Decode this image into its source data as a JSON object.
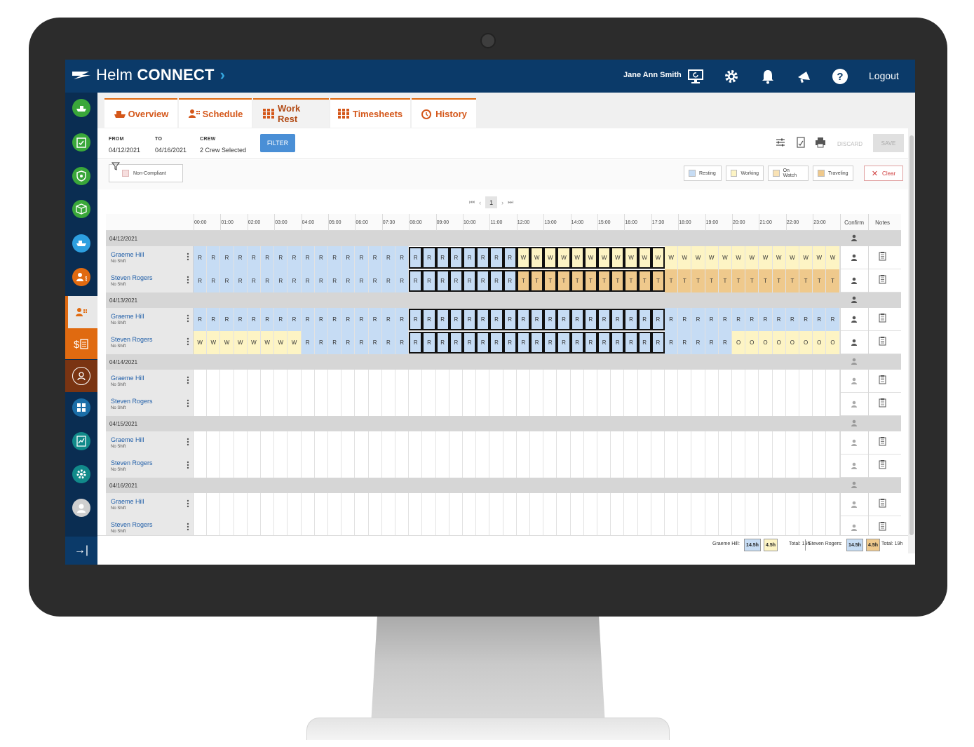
{
  "app": {
    "logo_text": "Helm",
    "logo_bold": "CONNECT",
    "logo_chevron": "›"
  },
  "header": {
    "user": "Jane Ann Smith",
    "logout": "Logout",
    "icons": [
      "monitor-icon",
      "gear-icon",
      "bell-icon",
      "megaphone-icon",
      "help-icon"
    ]
  },
  "tabs": [
    {
      "label": "Overview",
      "icon": "ship-icon"
    },
    {
      "label": "Schedule",
      "icon": "crew-schedule-icon"
    },
    {
      "label": "Work Rest",
      "icon": "grid-icon",
      "active": true
    },
    {
      "label": "Timesheets",
      "icon": "grid-icon"
    },
    {
      "label": "History",
      "icon": "history-icon"
    }
  ],
  "filter": {
    "from_label": "FROM",
    "from": "04/12/2021",
    "to_label": "TO",
    "to": "04/16/2021",
    "crew_label": "CREW",
    "crew": "2 Crew Selected",
    "filter_btn": "FILTER",
    "discard": "DISCARD",
    "save": "SAVE"
  },
  "legend": {
    "non_compliant": "Non-Compliant",
    "items": [
      {
        "label": "Resting",
        "color": "#c6dcf4"
      },
      {
        "label": "Working",
        "color": "#fdf4c4"
      },
      {
        "label": "On Watch",
        "color": "#f9e2b4"
      },
      {
        "label": "Traveling",
        "color": "#efc98c"
      }
    ],
    "clear": "Clear"
  },
  "pager": {
    "first": "⏮",
    "prev": "‹",
    "page": "1",
    "next": "›",
    "last": "⏭"
  },
  "columns": {
    "hours": [
      "00:00",
      "01:00",
      "02:00",
      "03:00",
      "04:00",
      "05:00",
      "06:00",
      "07:30",
      "08:00",
      "09:00",
      "10:00",
      "11:00",
      "12:00",
      "13:00",
      "14:00",
      "15:00",
      "16:00",
      "17:30",
      "18:00",
      "19:00",
      "20:00",
      "21:00",
      "22:00",
      "23:00"
    ],
    "confirm": "Confirm",
    "notes": "Notes"
  },
  "colors": {
    "R": "#c6dcf4",
    "W": "#fdf4c4",
    "T": "#efc98c",
    "O": "#fdf4c4",
    "": "#ffffff"
  },
  "days": [
    {
      "date": "04/12/2021",
      "crew": [
        {
          "name": "Graeme Hill",
          "shift": "No Shift",
          "cells": "RRRRRRRRRRRRRRRRRRRRRRRRWWWWWWWWWWWWWWWWWWWWWWWW"
        },
        {
          "name": "Steven Rogers",
          "shift": "No Shift",
          "cells": "RRRRRRRRRRRRRRRRRRRRRRRRTTTTTTTTTTTTTTTTTTTTTTTT"
        }
      ]
    },
    {
      "date": "04/13/2021",
      "crew": [
        {
          "name": "Graeme Hill",
          "shift": "No Shift",
          "cells": "RRRRRRRRRRRRRRRRRRRRRRRRRRRRRRRRRRRRRRRRRRRRRRRR"
        },
        {
          "name": "Steven Rogers",
          "shift": "No Shift",
          "cells": "WWWWWWWWRRRRRRRRRRRRRRRRRRRRRRRRRRRRRRRROOOOOOOO"
        }
      ]
    },
    {
      "date": "04/14/2021",
      "crew": [
        {
          "name": "Graeme Hill",
          "shift": "No Shift",
          "cells": ""
        },
        {
          "name": "Steven Rogers",
          "shift": "No Shift",
          "cells": ""
        }
      ]
    },
    {
      "date": "04/15/2021",
      "crew": [
        {
          "name": "Graeme Hill",
          "shift": "No Shift",
          "cells": ""
        },
        {
          "name": "Steven Rogers",
          "shift": "No Shift",
          "cells": ""
        }
      ]
    },
    {
      "date": "04/16/2021",
      "crew": [
        {
          "name": "Graeme Hill",
          "shift": "No Shift",
          "cells": ""
        },
        {
          "name": "Steven Rogers",
          "shift": "No Shift",
          "cells": ""
        }
      ]
    }
  ],
  "totals": [
    {
      "name": "Graeme Hill:",
      "rest": "14.5h",
      "work": "4.5h",
      "total": "Total: 19h"
    },
    {
      "name": "Steven Rogers:",
      "rest": "14.5h",
      "work": "4.5h",
      "total": "Total: 19h"
    }
  ],
  "sidebar": {
    "icons": [
      "vessel-icon",
      "checklist-icon",
      "shield-icon",
      "package-icon",
      "ship-icon",
      "crew-pay-icon",
      "crew-schedule-icon",
      "payroll-icon",
      "person-badge-icon",
      "dashboard-icon",
      "report-icon",
      "settings-icon",
      "user-icon"
    ],
    "collapse": "→|"
  }
}
